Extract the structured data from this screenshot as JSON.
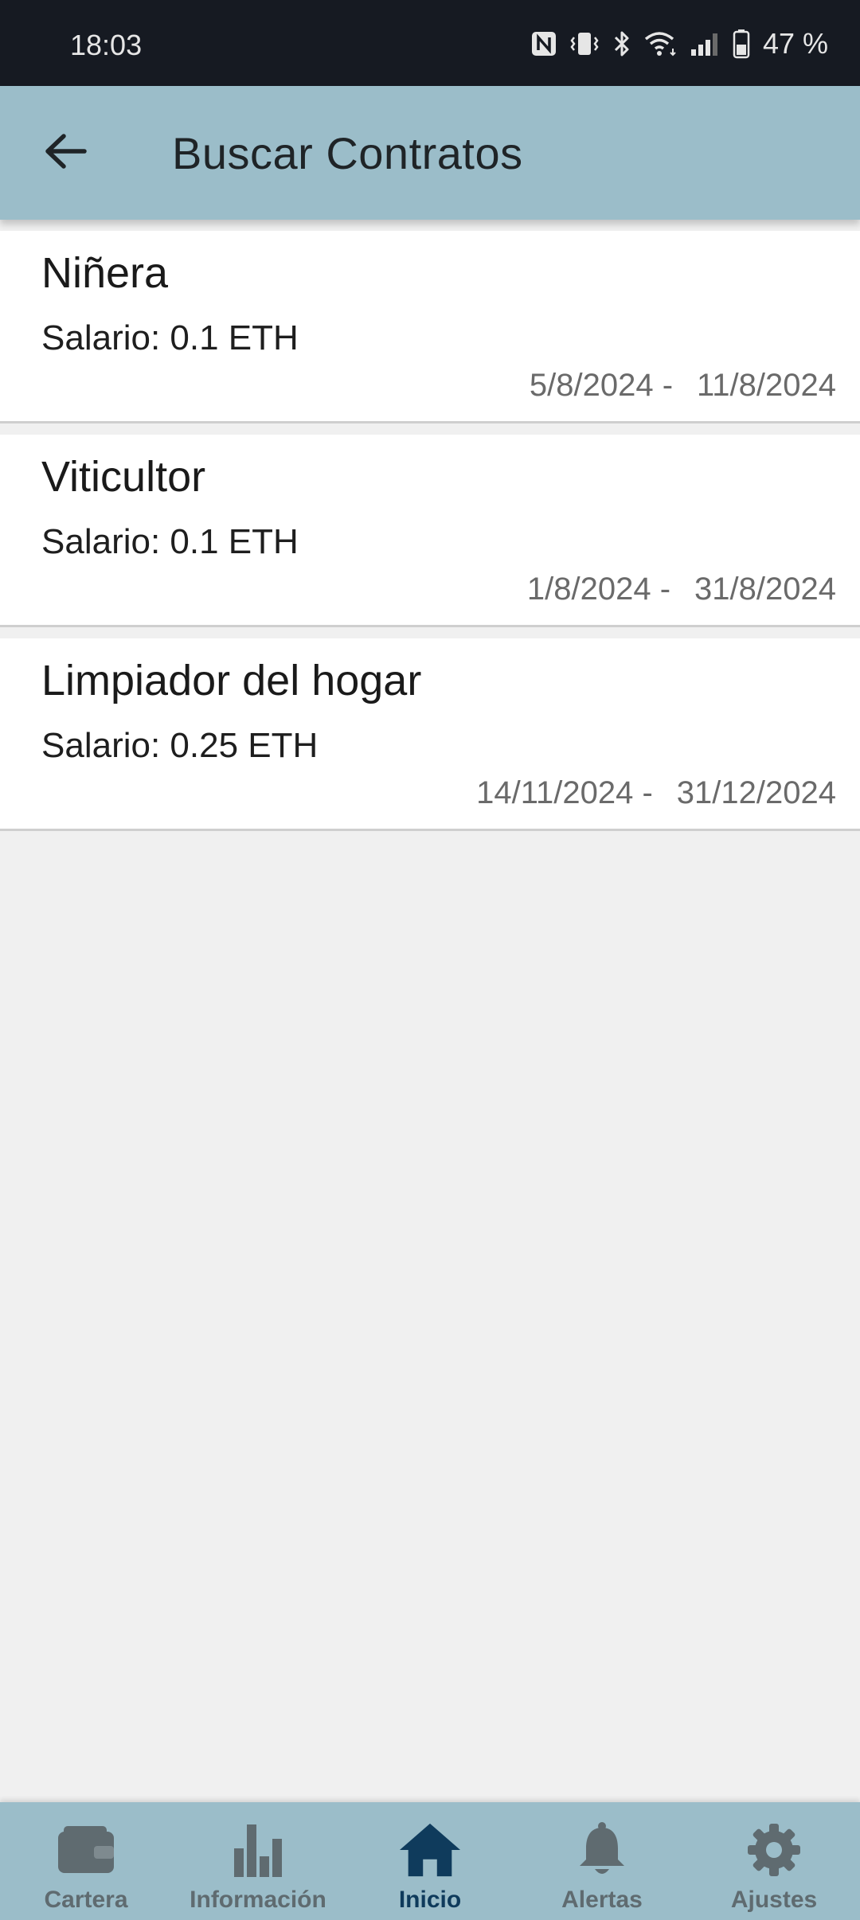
{
  "status_bar": {
    "time": "18:03",
    "battery": "47 %",
    "icons": [
      "nfc-icon",
      "vibrate-icon",
      "bluetooth-icon",
      "wifi-icon",
      "signal-icon",
      "battery-icon"
    ]
  },
  "app_bar": {
    "title": "Buscar Contratos",
    "back_icon": "arrow-left-icon"
  },
  "contracts": [
    {
      "title": "Niñera",
      "salary": "Salario: 0.1 ETH",
      "start": "5/8/2024 -",
      "end": "11/8/2024"
    },
    {
      "title": "Viticultor",
      "salary": "Salario: 0.1 ETH",
      "start": "1/8/2024 -",
      "end": "31/8/2024"
    },
    {
      "title": "Limpiador del hogar",
      "salary": "Salario: 0.25 ETH",
      "start": "14/11/2024 -",
      "end": "31/12/2024"
    }
  ],
  "bottom_nav": {
    "items": [
      {
        "label": "Cartera",
        "icon": "wallet-icon",
        "active": false
      },
      {
        "label": "Información",
        "icon": "bar-chart-icon",
        "active": false
      },
      {
        "label": "Inicio",
        "icon": "home-icon",
        "active": true
      },
      {
        "label": "Alertas",
        "icon": "bell-icon",
        "active": false
      },
      {
        "label": "Ajustes",
        "icon": "gear-icon",
        "active": false
      }
    ]
  },
  "colors": {
    "app_bar": "#9bbdc9",
    "status_bar": "#161a22",
    "background": "#f0f0f0",
    "nav_active": "#0f3b5c",
    "nav_inactive": "#5f6b70"
  }
}
